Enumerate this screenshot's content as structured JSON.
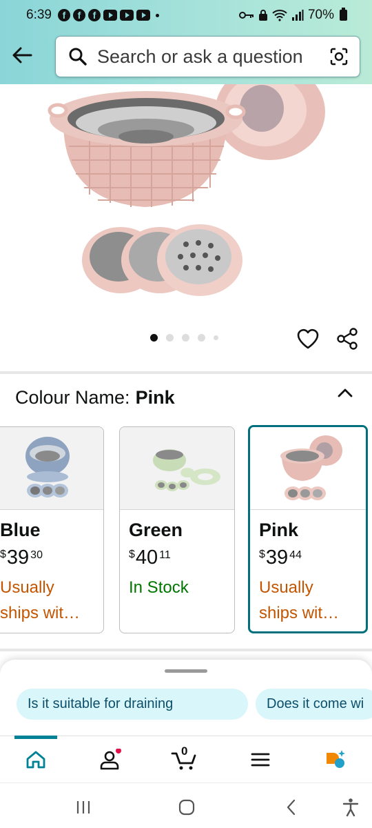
{
  "status_bar": {
    "time": "6:39",
    "battery": "70%",
    "notification_icons": [
      "facebook-icon",
      "facebook-icon",
      "facebook-icon",
      "youtube-icon",
      "youtube-icon",
      "youtube-icon"
    ]
  },
  "search": {
    "placeholder": "Search or ask a question"
  },
  "gallery": {
    "page_count": 5,
    "active_index": 0
  },
  "colour_selector": {
    "label": "Colour Name:",
    "selected_value": "Pink",
    "options": [
      {
        "name": "Blue",
        "currency": "$",
        "price_whole": "39",
        "price_cents": "30",
        "availability": "Usually ships wit...",
        "availability_line1": "Usually",
        "availability_line2": "ships wit…",
        "selected": false
      },
      {
        "name": "Green",
        "currency": "$",
        "price_whole": "40",
        "price_cents": "11",
        "availability": "In Stock",
        "availability_line1": "In Stock",
        "availability_line2": "",
        "selected": false
      },
      {
        "name": "Pink",
        "currency": "$",
        "price_whole": "39",
        "price_cents": "44",
        "availability": "Usually ships wit...",
        "availability_line1": "Usually",
        "availability_line2": "ships wit…",
        "selected": true
      }
    ]
  },
  "suggestions": {
    "chips": [
      "Is it suitable for draining",
      "Does it come wi"
    ]
  },
  "bottom_nav": {
    "items": [
      "home-icon",
      "account-icon",
      "cart-icon",
      "menu-icon",
      "rufus-icon"
    ],
    "cart_count": "0",
    "active": "home"
  },
  "colors": {
    "header_gradient_start": "#8ad5d8",
    "header_gradient_end": "#b9ebd7",
    "selected_border": "#00707f",
    "availability_orange": "#c45500",
    "availability_green": "#007600",
    "chip_bg": "#d9f6fa",
    "nav_accent": "#008296",
    "notification_dot": "#e3124a"
  }
}
